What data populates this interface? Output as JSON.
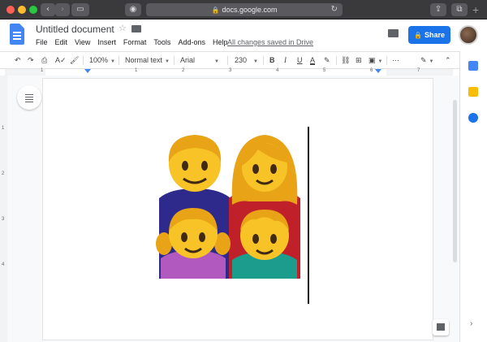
{
  "browser": {
    "url": "docs.google.com",
    "back_icon": "‹",
    "forward_icon": "›",
    "reload_icon": "↻",
    "plus_icon": "+",
    "traffic_colors": [
      "#fe5f57",
      "#febc2e",
      "#28c840"
    ]
  },
  "doc": {
    "title": "Untitled document",
    "menu": [
      "File",
      "Edit",
      "View",
      "Insert",
      "Format",
      "Tools",
      "Add-ons",
      "Help"
    ],
    "save_status": "All changes saved in Drive",
    "share_label": "Share",
    "accent_color": "#1a73e8"
  },
  "toolbar": {
    "zoom": "100%",
    "style": "Normal text",
    "font": "Arial",
    "size": "230",
    "bold": "B",
    "italic": "I",
    "underline": "U",
    "text_color": "A",
    "more": "···"
  },
  "ruler": {
    "numbers": [
      "1",
      "1",
      "2",
      "3",
      "4",
      "5",
      "6",
      "7"
    ],
    "vertical_numbers": [
      "1",
      "2",
      "3",
      "4"
    ]
  },
  "content": {
    "image_name": "family emoji",
    "people": [
      "man",
      "woman",
      "girl",
      "boy"
    ]
  },
  "side_panel": {
    "icons": [
      "calendar-icon",
      "keep-icon",
      "tasks-icon"
    ],
    "expand_icon": "›"
  }
}
